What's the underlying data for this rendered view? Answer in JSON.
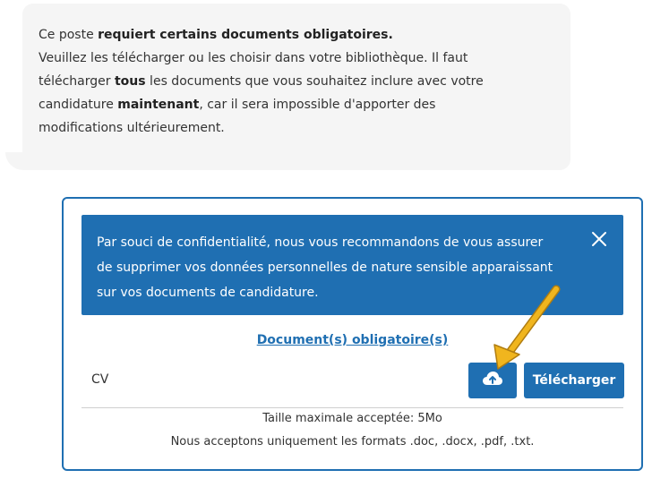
{
  "message": {
    "line1_pre": "Ce poste ",
    "line1_bold": "requiert certains documents obligatoires.",
    "line2": "Veuillez les télécharger ou les choisir dans votre bibliothèque. Il faut",
    "line3_pre": "télécharger ",
    "line3_bold": "tous",
    "line3_post": " les documents que vous souhaitez inclure avec votre",
    "line4_pre": "candidature ",
    "line4_bold": "maintenant",
    "line4_post": ", car il sera impossible d'apporter des",
    "line5": "modifications ultérieurement."
  },
  "alert": {
    "line1": "Par souci de confidentialité, nous vous recommandons de vous assurer",
    "line2": "de supprimer vos données personnelles de nature sensible apparaissant",
    "line3": "sur vos documents de candidature.",
    "close_icon": "close-icon"
  },
  "documents": {
    "section_link": "Document(s) obligatoire(s)",
    "item_label": "CV",
    "cloud_icon": "cloud-upload-icon",
    "upload_label": "Télécharger",
    "max_size": "Taille maximale acceptée: 5Mo",
    "formats": "Nous acceptons uniquement les formats .doc, .docx, .pdf, .txt."
  },
  "colors": {
    "primary": "#1f6fb2",
    "bubble_bg": "#f5f5f5",
    "arrow": "#f0b51e"
  }
}
